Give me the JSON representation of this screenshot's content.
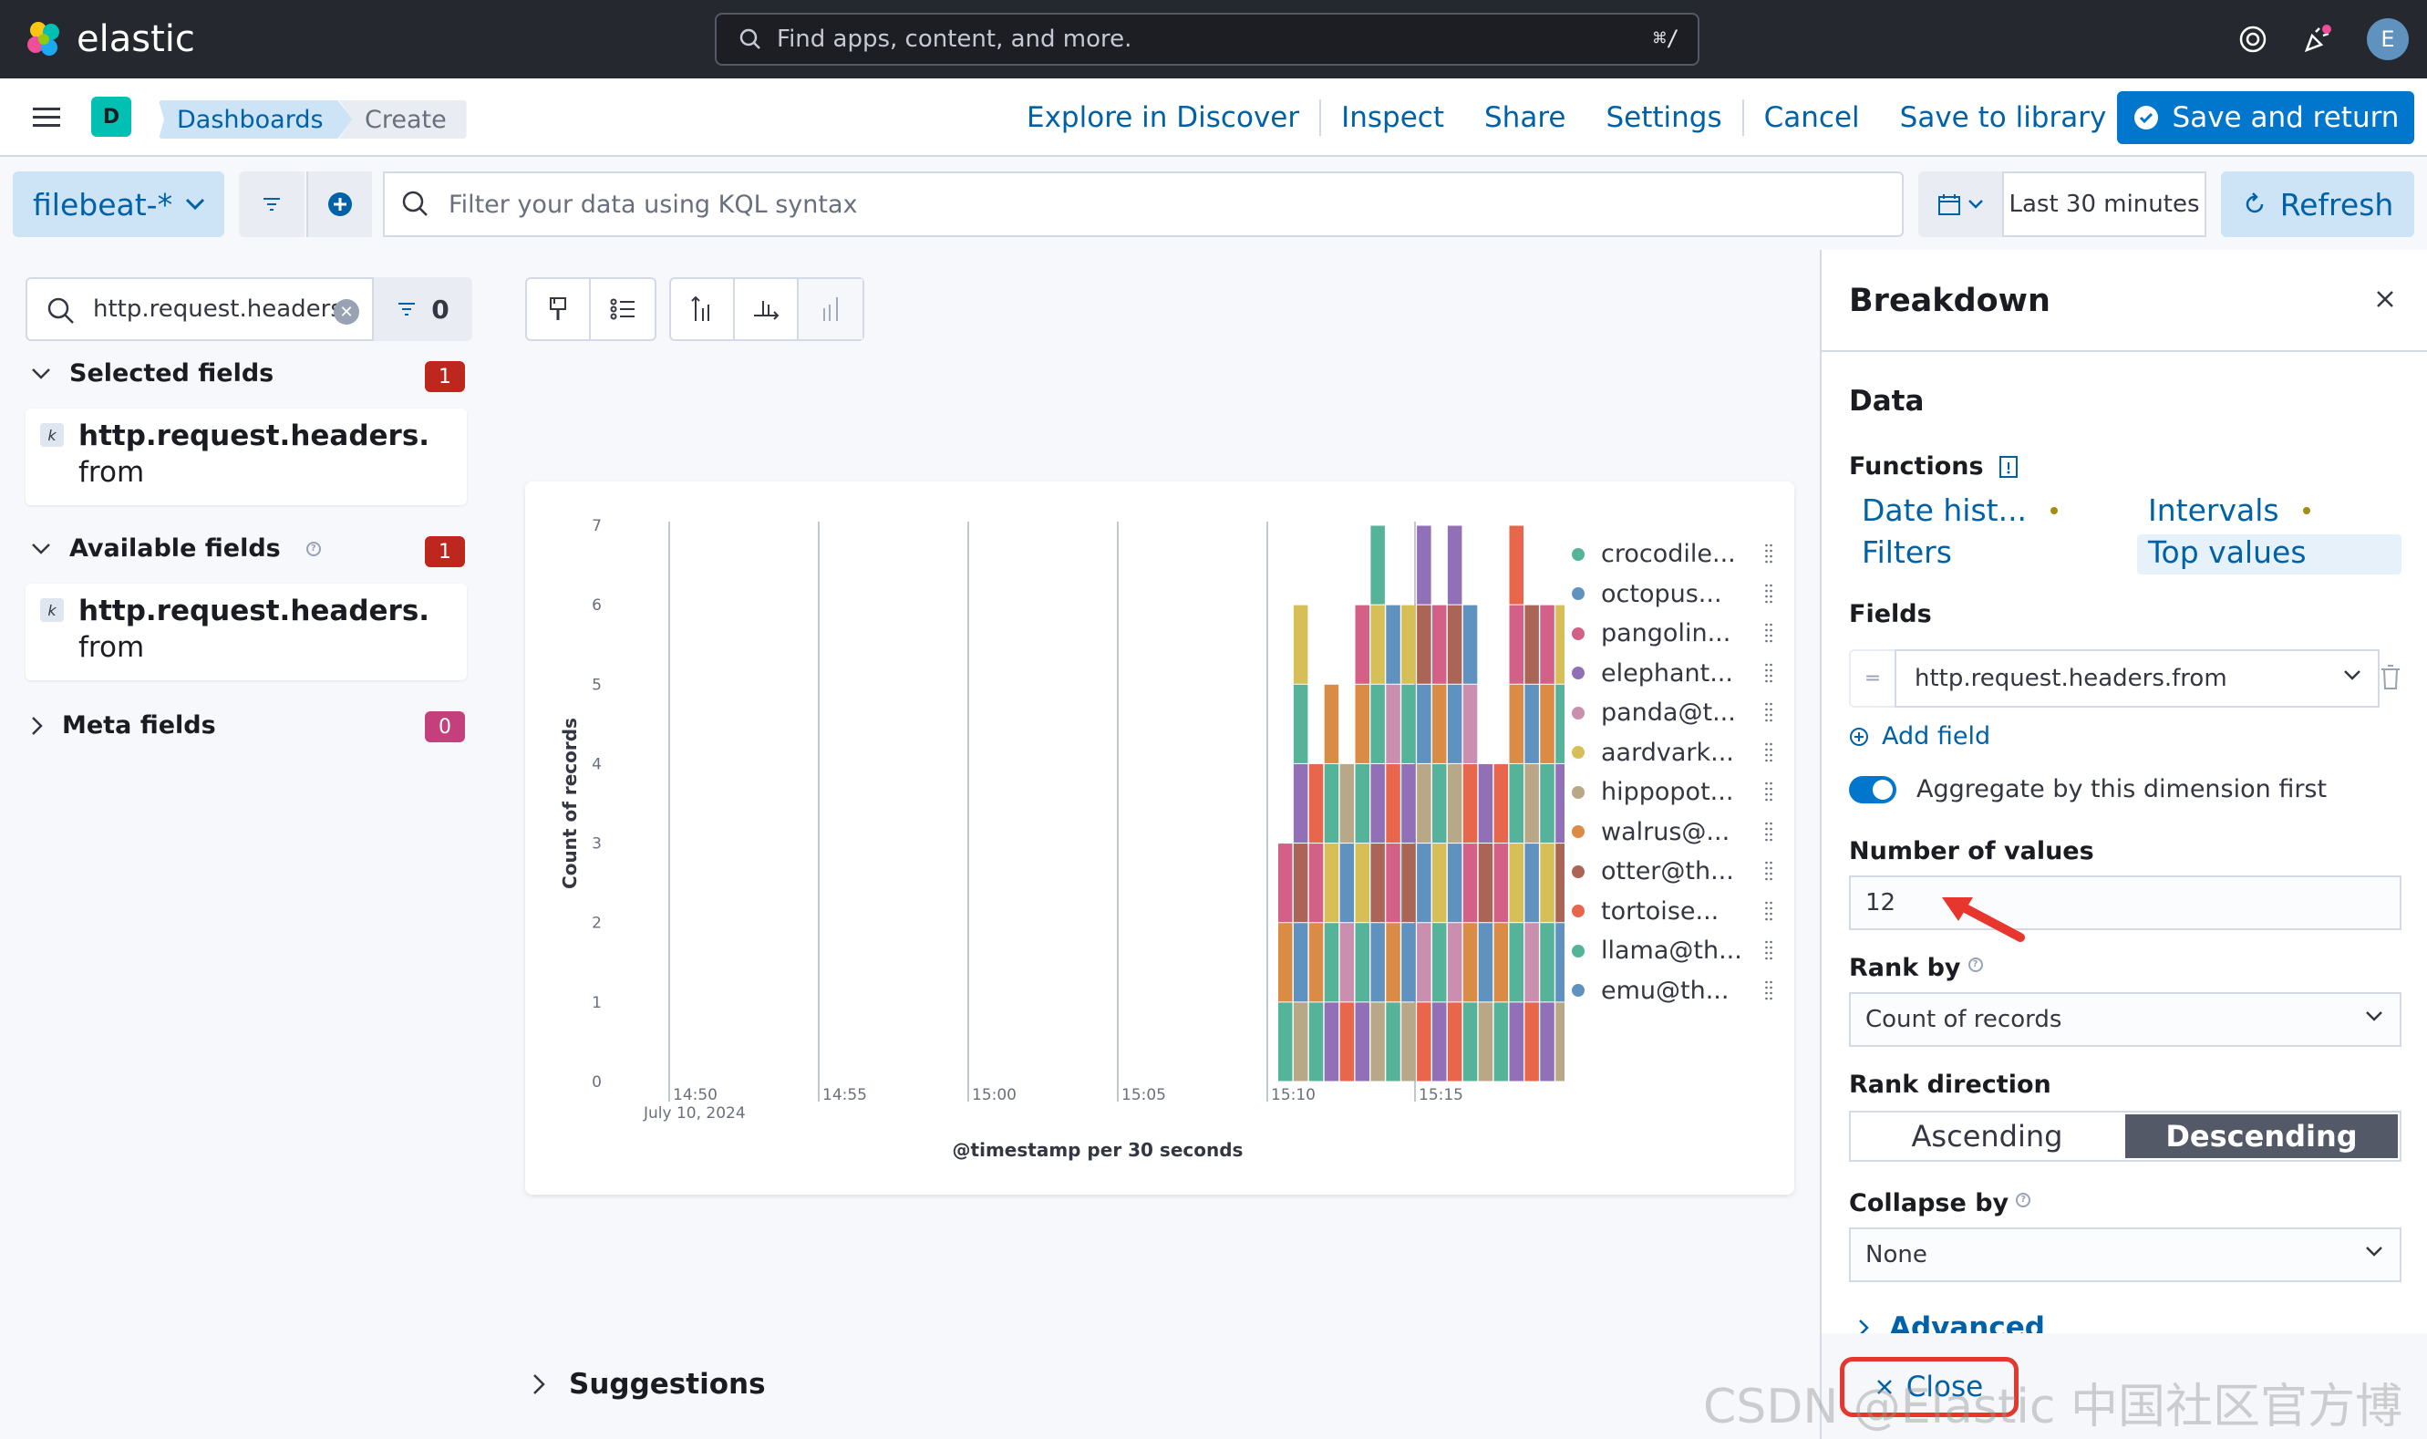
{
  "header": {
    "brand": "elastic",
    "search_placeholder": "Find apps, content, and more.",
    "search_shortcut": "⌘/",
    "avatar_initial": "E"
  },
  "appbar": {
    "space_initial": "D",
    "breadcrumbs": [
      "Dashboards",
      "Create"
    ],
    "links": [
      "Explore in Discover",
      "Inspect",
      "Share",
      "Settings",
      "Cancel",
      "Save to library"
    ],
    "primary_button": "Save and return"
  },
  "querybar": {
    "data_view": "filebeat-*",
    "kql_placeholder": "Filter your data using KQL syntax",
    "date_range": "Last 30 minutes",
    "refresh_label": "Refresh"
  },
  "fieldlist": {
    "search_value": "http.request.headers",
    "filter_count": "0",
    "selected": {
      "label": "Selected fields",
      "count": "1",
      "field_bold": "http.request.headers.",
      "field_rest": "from"
    },
    "available": {
      "label": "Available fields",
      "count": "1",
      "field_bold": "http.request.headers.",
      "field_rest": "from"
    },
    "meta": {
      "label": "Meta fields",
      "count": "0"
    }
  },
  "chart_data": {
    "type": "bar",
    "stacked": true,
    "ylabel": "Count of records",
    "xlabel": "@timestamp per 30 seconds",
    "ylim": [
      0,
      7
    ],
    "yticks": [
      "0",
      "1",
      "2",
      "3",
      "4",
      "5",
      "6",
      "7"
    ],
    "xticks": [
      "14:50",
      "14:55",
      "15:00",
      "15:05",
      "15:10",
      "15:15"
    ],
    "xtick_sublabel": "July 10, 2024",
    "bar_totals": [
      3,
      6,
      4,
      5,
      4,
      6,
      7,
      6,
      6,
      7,
      6,
      7,
      6,
      4,
      4,
      7,
      6,
      6,
      6
    ],
    "series": [
      {
        "name": "crocodile...",
        "color": "#54b399"
      },
      {
        "name": "octopus...",
        "color": "#6092c0"
      },
      {
        "name": "pangolin...",
        "color": "#d36086"
      },
      {
        "name": "elephant...",
        "color": "#9170b8"
      },
      {
        "name": "panda@t...",
        "color": "#ca8eae"
      },
      {
        "name": "aardvark...",
        "color": "#d6bf57"
      },
      {
        "name": "hippopot...",
        "color": "#b9a888"
      },
      {
        "name": "walrus@...",
        "color": "#da8b45"
      },
      {
        "name": "otter@th...",
        "color": "#aa6556"
      },
      {
        "name": "tortoise...",
        "color": "#e7664c"
      },
      {
        "name": "llama@th...",
        "color": "#54b399"
      },
      {
        "name": "emu@th...",
        "color": "#6092c0"
      }
    ]
  },
  "suggestions_label": "Suggestions",
  "flyout": {
    "title": "Breakdown",
    "data_heading": "Data",
    "functions_label": "Functions",
    "functions": [
      "Date hist...",
      "Intervals",
      "Filters",
      "Top values"
    ],
    "fields_label": "Fields",
    "field_value": "http.request.headers.from",
    "add_field": "Add field",
    "aggregate_label": "Aggregate by this dimension first",
    "num_values_label": "Number of values",
    "num_values": "12",
    "rank_by_label": "Rank by",
    "rank_by_value": "Count of records",
    "rank_direction_label": "Rank direction",
    "rank_options": [
      "Ascending",
      "Descending"
    ],
    "collapse_label": "Collapse by",
    "collapse_value": "None",
    "advanced": "Advanced",
    "close": "Close"
  },
  "watermark": "CSDN @Elastic 中国社区官方博客"
}
